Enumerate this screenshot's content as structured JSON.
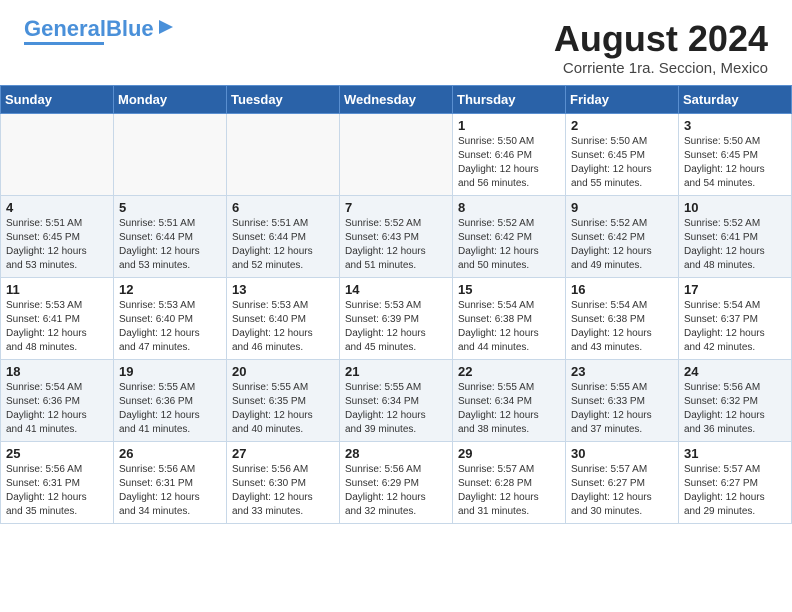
{
  "logo": {
    "part1": "General",
    "part2": "Blue",
    "tagline": ""
  },
  "title": "August 2024",
  "subtitle": "Corriente 1ra. Seccion, Mexico",
  "days_of_week": [
    "Sunday",
    "Monday",
    "Tuesday",
    "Wednesday",
    "Thursday",
    "Friday",
    "Saturday"
  ],
  "weeks": [
    [
      {
        "day": "",
        "info": ""
      },
      {
        "day": "",
        "info": ""
      },
      {
        "day": "",
        "info": ""
      },
      {
        "day": "",
        "info": ""
      },
      {
        "day": "1",
        "info": "Sunrise: 5:50 AM\nSunset: 6:46 PM\nDaylight: 12 hours\nand 56 minutes."
      },
      {
        "day": "2",
        "info": "Sunrise: 5:50 AM\nSunset: 6:45 PM\nDaylight: 12 hours\nand 55 minutes."
      },
      {
        "day": "3",
        "info": "Sunrise: 5:50 AM\nSunset: 6:45 PM\nDaylight: 12 hours\nand 54 minutes."
      }
    ],
    [
      {
        "day": "4",
        "info": "Sunrise: 5:51 AM\nSunset: 6:45 PM\nDaylight: 12 hours\nand 53 minutes."
      },
      {
        "day": "5",
        "info": "Sunrise: 5:51 AM\nSunset: 6:44 PM\nDaylight: 12 hours\nand 53 minutes."
      },
      {
        "day": "6",
        "info": "Sunrise: 5:51 AM\nSunset: 6:44 PM\nDaylight: 12 hours\nand 52 minutes."
      },
      {
        "day": "7",
        "info": "Sunrise: 5:52 AM\nSunset: 6:43 PM\nDaylight: 12 hours\nand 51 minutes."
      },
      {
        "day": "8",
        "info": "Sunrise: 5:52 AM\nSunset: 6:42 PM\nDaylight: 12 hours\nand 50 minutes."
      },
      {
        "day": "9",
        "info": "Sunrise: 5:52 AM\nSunset: 6:42 PM\nDaylight: 12 hours\nand 49 minutes."
      },
      {
        "day": "10",
        "info": "Sunrise: 5:52 AM\nSunset: 6:41 PM\nDaylight: 12 hours\nand 48 minutes."
      }
    ],
    [
      {
        "day": "11",
        "info": "Sunrise: 5:53 AM\nSunset: 6:41 PM\nDaylight: 12 hours\nand 48 minutes."
      },
      {
        "day": "12",
        "info": "Sunrise: 5:53 AM\nSunset: 6:40 PM\nDaylight: 12 hours\nand 47 minutes."
      },
      {
        "day": "13",
        "info": "Sunrise: 5:53 AM\nSunset: 6:40 PM\nDaylight: 12 hours\nand 46 minutes."
      },
      {
        "day": "14",
        "info": "Sunrise: 5:53 AM\nSunset: 6:39 PM\nDaylight: 12 hours\nand 45 minutes."
      },
      {
        "day": "15",
        "info": "Sunrise: 5:54 AM\nSunset: 6:38 PM\nDaylight: 12 hours\nand 44 minutes."
      },
      {
        "day": "16",
        "info": "Sunrise: 5:54 AM\nSunset: 6:38 PM\nDaylight: 12 hours\nand 43 minutes."
      },
      {
        "day": "17",
        "info": "Sunrise: 5:54 AM\nSunset: 6:37 PM\nDaylight: 12 hours\nand 42 minutes."
      }
    ],
    [
      {
        "day": "18",
        "info": "Sunrise: 5:54 AM\nSunset: 6:36 PM\nDaylight: 12 hours\nand 41 minutes."
      },
      {
        "day": "19",
        "info": "Sunrise: 5:55 AM\nSunset: 6:36 PM\nDaylight: 12 hours\nand 41 minutes."
      },
      {
        "day": "20",
        "info": "Sunrise: 5:55 AM\nSunset: 6:35 PM\nDaylight: 12 hours\nand 40 minutes."
      },
      {
        "day": "21",
        "info": "Sunrise: 5:55 AM\nSunset: 6:34 PM\nDaylight: 12 hours\nand 39 minutes."
      },
      {
        "day": "22",
        "info": "Sunrise: 5:55 AM\nSunset: 6:34 PM\nDaylight: 12 hours\nand 38 minutes."
      },
      {
        "day": "23",
        "info": "Sunrise: 5:55 AM\nSunset: 6:33 PM\nDaylight: 12 hours\nand 37 minutes."
      },
      {
        "day": "24",
        "info": "Sunrise: 5:56 AM\nSunset: 6:32 PM\nDaylight: 12 hours\nand 36 minutes."
      }
    ],
    [
      {
        "day": "25",
        "info": "Sunrise: 5:56 AM\nSunset: 6:31 PM\nDaylight: 12 hours\nand 35 minutes."
      },
      {
        "day": "26",
        "info": "Sunrise: 5:56 AM\nSunset: 6:31 PM\nDaylight: 12 hours\nand 34 minutes."
      },
      {
        "day": "27",
        "info": "Sunrise: 5:56 AM\nSunset: 6:30 PM\nDaylight: 12 hours\nand 33 minutes."
      },
      {
        "day": "28",
        "info": "Sunrise: 5:56 AM\nSunset: 6:29 PM\nDaylight: 12 hours\nand 32 minutes."
      },
      {
        "day": "29",
        "info": "Sunrise: 5:57 AM\nSunset: 6:28 PM\nDaylight: 12 hours\nand 31 minutes."
      },
      {
        "day": "30",
        "info": "Sunrise: 5:57 AM\nSunset: 6:27 PM\nDaylight: 12 hours\nand 30 minutes."
      },
      {
        "day": "31",
        "info": "Sunrise: 5:57 AM\nSunset: 6:27 PM\nDaylight: 12 hours\nand 29 minutes."
      }
    ]
  ]
}
